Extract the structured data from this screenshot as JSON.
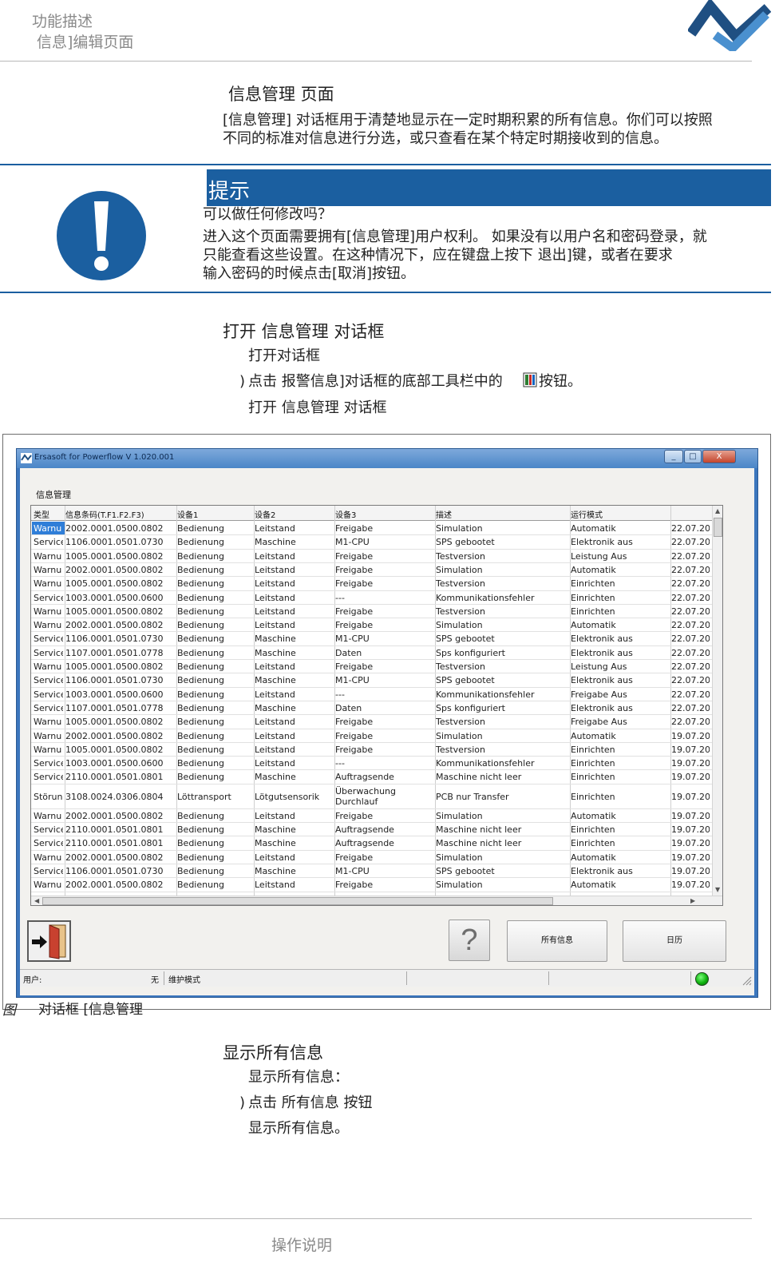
{
  "header": {
    "line1": "功能描述",
    "line2": "信息]编辑页面"
  },
  "intro": {
    "heading": "信息管理  页面",
    "paragraph_line1": "[信息管理] 对话框用于清楚地显示在一定时期积累的所有信息。你们可以按照",
    "paragraph_line2": "不同的标准对信息进行分选，或只查看在某个特定时期接收到的信息。"
  },
  "hint": {
    "title": "提示",
    "question": "可以做任何修改吗？",
    "line1": "进入这个页面需要拥有[信息管理]用户权利。 如果没有以用户名和密码登录，就",
    "line2": "只能查看这些设置。在这种情况下，应在键盘上按下        退出]键，或者在要求",
    "line3": "输入密码的时候点击[取消]按钮。"
  },
  "open_section": {
    "heading": "打开 信息管理  对话框",
    "sub": "打开对话框",
    "step_prefix": ")",
    "step_text_a": "点击 报警信息]对话框的底部工具栏中的",
    "step_text_b": "按钮。",
    "result": "打开 信息管理  对话框"
  },
  "window": {
    "title": "Ersasoft for Powerflow V 1.020.001",
    "min_label": "_",
    "max_label": "□",
    "close_label": "X",
    "panel_label": "信息管理",
    "columns": [
      "类型",
      "信息条码(T.F1.F2.F3)",
      "设备1",
      "设备2",
      "设备3",
      "描述",
      "运行模式",
      ""
    ],
    "rows": [
      [
        "Warnu",
        "2002.0001.0500.0802",
        "Bedienung",
        "Leitstand",
        "Freigabe",
        "Simulation",
        "Automatik",
        "22.07.20"
      ],
      [
        "Service",
        "1106.0001.0501.0730",
        "Bedienung",
        "Maschine",
        "M1-CPU",
        "SPS gebootet",
        "Elektronik aus",
        "22.07.20"
      ],
      [
        "Warnu",
        "1005.0001.0500.0802",
        "Bedienung",
        "Leitstand",
        "Freigabe",
        "Testversion",
        "Leistung Aus",
        "22.07.20"
      ],
      [
        "Warnu",
        "2002.0001.0500.0802",
        "Bedienung",
        "Leitstand",
        "Freigabe",
        "Simulation",
        "Automatik",
        "22.07.20"
      ],
      [
        "Warnu",
        "1005.0001.0500.0802",
        "Bedienung",
        "Leitstand",
        "Freigabe",
        "Testversion",
        "Einrichten",
        "22.07.20"
      ],
      [
        "Service",
        "1003.0001.0500.0600",
        "Bedienung",
        "Leitstand",
        "---",
        "Kommunikationsfehler",
        "Einrichten",
        "22.07.20"
      ],
      [
        "Warnu",
        "1005.0001.0500.0802",
        "Bedienung",
        "Leitstand",
        "Freigabe",
        "Testversion",
        "Einrichten",
        "22.07.20"
      ],
      [
        "Warnu",
        "2002.0001.0500.0802",
        "Bedienung",
        "Leitstand",
        "Freigabe",
        "Simulation",
        "Automatik",
        "22.07.20"
      ],
      [
        "Service",
        "1106.0001.0501.0730",
        "Bedienung",
        "Maschine",
        "M1-CPU",
        "SPS gebootet",
        "Elektronik aus",
        "22.07.20"
      ],
      [
        "Service",
        "1107.0001.0501.0778",
        "Bedienung",
        "Maschine",
        "Daten",
        "Sps konfiguriert",
        "Elektronik aus",
        "22.07.20"
      ],
      [
        "Warnu",
        "1005.0001.0500.0802",
        "Bedienung",
        "Leitstand",
        "Freigabe",
        "Testversion",
        "Leistung Aus",
        "22.07.20"
      ],
      [
        "Service",
        "1106.0001.0501.0730",
        "Bedienung",
        "Maschine",
        "M1-CPU",
        "SPS gebootet",
        "Elektronik aus",
        "22.07.20"
      ],
      [
        "Service",
        "1003.0001.0500.0600",
        "Bedienung",
        "Leitstand",
        "---",
        "Kommunikationsfehler",
        "Freigabe Aus",
        "22.07.20"
      ],
      [
        "Service",
        "1107.0001.0501.0778",
        "Bedienung",
        "Maschine",
        "Daten",
        "Sps konfiguriert",
        "Elektronik aus",
        "22.07.20"
      ],
      [
        "Warnu",
        "1005.0001.0500.0802",
        "Bedienung",
        "Leitstand",
        "Freigabe",
        "Testversion",
        "Freigabe Aus",
        "22.07.20"
      ],
      [
        "Warnu",
        "2002.0001.0500.0802",
        "Bedienung",
        "Leitstand",
        "Freigabe",
        "Simulation",
        "Automatik",
        "19.07.20"
      ],
      [
        "Warnu",
        "1005.0001.0500.0802",
        "Bedienung",
        "Leitstand",
        "Freigabe",
        "Testversion",
        "Einrichten",
        "19.07.20"
      ],
      [
        "Service",
        "1003.0001.0500.0600",
        "Bedienung",
        "Leitstand",
        "---",
        "Kommunikationsfehler",
        "Einrichten",
        "19.07.20"
      ],
      [
        "Service",
        "2110.0001.0501.0801",
        "Bedienung",
        "Maschine",
        "Auftragsende",
        "Maschine nicht leer",
        "Einrichten",
        "19.07.20"
      ],
      [
        "Störun",
        "3108.0024.0306.0804",
        "Löttransport",
        "Lötgutsensorik",
        "Überwachung Durchlauf",
        "PCB nur Transfer",
        "Einrichten",
        "19.07.20"
      ],
      [
        "Warnu",
        "2002.0001.0500.0802",
        "Bedienung",
        "Leitstand",
        "Freigabe",
        "Simulation",
        "Automatik",
        "19.07.20"
      ],
      [
        "Service",
        "2110.0001.0501.0801",
        "Bedienung",
        "Maschine",
        "Auftragsende",
        "Maschine nicht leer",
        "Einrichten",
        "19.07.20"
      ],
      [
        "Service",
        "2110.0001.0501.0801",
        "Bedienung",
        "Maschine",
        "Auftragsende",
        "Maschine nicht leer",
        "Einrichten",
        "19.07.20"
      ],
      [
        "Warnu",
        "2002.0001.0500.0802",
        "Bedienung",
        "Leitstand",
        "Freigabe",
        "Simulation",
        "Automatik",
        "19.07.20"
      ],
      [
        "Service",
        "1106.0001.0501.0730",
        "Bedienung",
        "Maschine",
        "M1-CPU",
        "SPS gebootet",
        "Elektronik aus",
        "19.07.20"
      ],
      [
        "Warnu",
        "2002.0001.0500.0802",
        "Bedienung",
        "Leitstand",
        "Freigabe",
        "Simulation",
        "Automatik",
        "19.07.20"
      ]
    ],
    "help_label": "?",
    "all_messages_button": "所有信息",
    "calendar_button": "日历",
    "status_user_label": "用户:",
    "status_user_value": "无",
    "status_mode": "维护模式",
    "status_led_color": "#19c219"
  },
  "figure": {
    "prefix": "图",
    "caption": "对话框 [信息管理"
  },
  "show_section": {
    "heading": "显示所有信息",
    "sub": "显示所有信息：",
    "step_prefix": ")",
    "step_text": "点击 所有信息  按钮",
    "result": "显示所有信息。"
  },
  "footer": {
    "text": "操作说明"
  },
  "colors": {
    "accent_blue": "#1b5fa0",
    "selection_blue": "#2f7ed8"
  }
}
